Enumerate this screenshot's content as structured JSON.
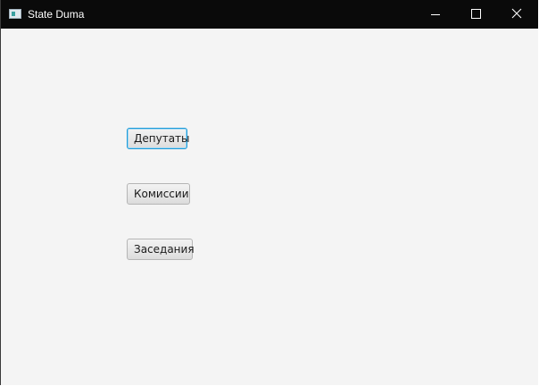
{
  "window": {
    "title": "State Duma",
    "icon": "java-app-icon",
    "controls": {
      "minimize": "minimize-icon",
      "maximize": "maximize-icon",
      "close": "close-icon"
    }
  },
  "main": {
    "buttons": [
      {
        "label": "Депутаты",
        "focused": true
      },
      {
        "label": "Комиссии",
        "focused": false
      },
      {
        "label": "Заседания",
        "focused": false
      }
    ]
  },
  "colors": {
    "titlebar": "#0a0a0a",
    "background": "#f4f4f4",
    "focus_accent": "#1e9bd8"
  }
}
